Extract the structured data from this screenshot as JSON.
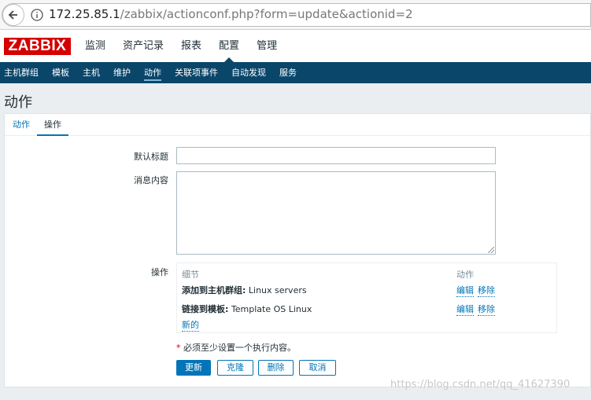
{
  "browser": {
    "url_host": "172.25.85.1",
    "url_path": "/zabbix/actionconf.php?form=update&actionid=2"
  },
  "header": {
    "logo": "ZABBIX",
    "main_menu": [
      "监测",
      "资产记录",
      "报表",
      "配置",
      "管理"
    ],
    "active_main": "配置",
    "sub_menu": [
      "主机群组",
      "模板",
      "主机",
      "维护",
      "动作",
      "关联项事件",
      "自动发现",
      "服务"
    ],
    "active_sub": "动作"
  },
  "page": {
    "title": "动作",
    "tabs": [
      "动作",
      "操作"
    ],
    "active_tab": "操作"
  },
  "form": {
    "subject_label": "默认标题",
    "subject_value": "",
    "message_label": "消息内容",
    "message_value": "",
    "operations_label": "操作",
    "operations": {
      "col_details": "细节",
      "col_action": "动作",
      "rows": [
        {
          "prefix": "添加到主机群组:",
          "value": " Linux servers",
          "edit": "编辑",
          "remove": "移除"
        },
        {
          "prefix": "链接到模板:",
          "value": " Template OS Linux",
          "edit": "编辑",
          "remove": "移除"
        }
      ],
      "new_link": "新的"
    },
    "required_note": "必须至少设置一个执行内容。",
    "required_star": "*",
    "buttons": {
      "update": "更新",
      "clone": "克隆",
      "delete": "删除",
      "cancel": "取消"
    }
  },
  "watermark": "https://blog.csdn.net/qq_41627390",
  "colors": {
    "brand_red": "#d40000",
    "nav_blue": "#0a466a",
    "link_blue": "#0275b8"
  }
}
